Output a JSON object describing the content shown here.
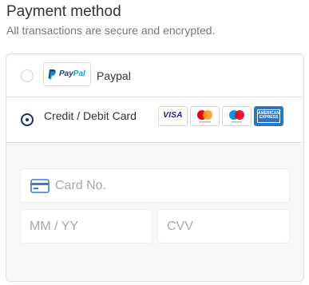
{
  "header": {
    "title": "Payment method",
    "subtitle": "All transactions are secure and encrypted."
  },
  "options": {
    "paypal": {
      "label": "Paypal",
      "logo_text_pay": "Pay",
      "logo_text_pal": "Pal",
      "selected": false
    },
    "card": {
      "label": "Credit / Debit Card",
      "selected": true
    }
  },
  "brands": {
    "visa": "VISA",
    "amex": "AMERICAN EXPRESS"
  },
  "form": {
    "card_number_placeholder": "Card No.",
    "expiry_placeholder": "MM / YY",
    "cvv_placeholder": "CVV"
  },
  "colors": {
    "radio_selected": "#1b2f6b",
    "paypal_dark": "#253b80",
    "paypal_light": "#179bd7",
    "visa": "#1a1f71",
    "mastercard_red": "#eb001b",
    "mastercard_orange": "#f79e1b",
    "maestro_blue": "#0099df",
    "amex": "#2e77bc",
    "card_icon": "#3a7bd5"
  },
  "icons": {
    "paypal": "paypal-logo-icon",
    "visa": "visa-logo-icon",
    "mastercard": "mastercard-logo-icon",
    "maestro": "maestro-logo-icon",
    "amex": "amex-logo-icon",
    "card": "credit-card-icon"
  }
}
